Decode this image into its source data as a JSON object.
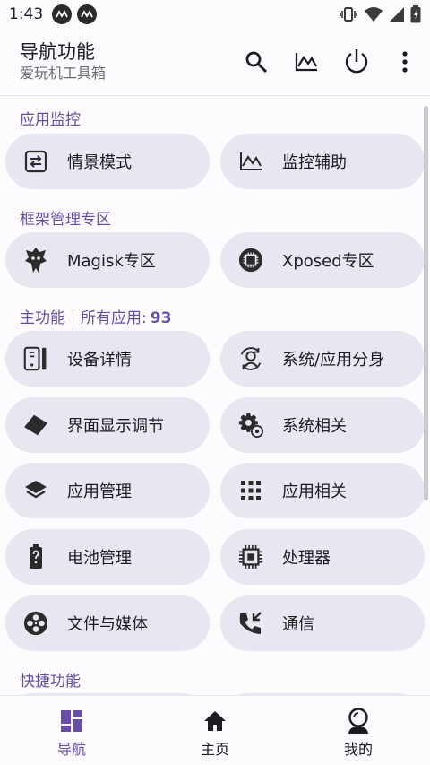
{
  "status_bar": {
    "time": "1:43"
  },
  "app_bar": {
    "title": "导航功能",
    "subtitle": "爱玩机工具箱"
  },
  "sections": {
    "app_monitor": "应用监控",
    "framework": "框架管理专区",
    "main_label": "主功能",
    "main_all_apps": "所有应用:",
    "main_app_count": "93",
    "shortcuts": "快捷功能"
  },
  "cards": {
    "scene_mode": "情景模式",
    "monitor_assist": "监控辅助",
    "magisk": "Magisk专区",
    "xposed": "Xposed专区",
    "device_details": "设备详情",
    "system_clone": "系统/应用分身",
    "display_adjust": "界面显示调节",
    "system_related": "系统相关",
    "app_manage": "应用管理",
    "app_related": "应用相关",
    "battery_manage": "电池管理",
    "processor": "处理器",
    "file_media": "文件与媒体",
    "communication": "通信"
  },
  "bottom_nav": {
    "nav": "导航",
    "home": "主页",
    "mine": "我的",
    "active": "nav"
  },
  "colors": {
    "accent": "#6750a4",
    "card_bg": "#e9e5f1",
    "background": "#fefbff"
  }
}
